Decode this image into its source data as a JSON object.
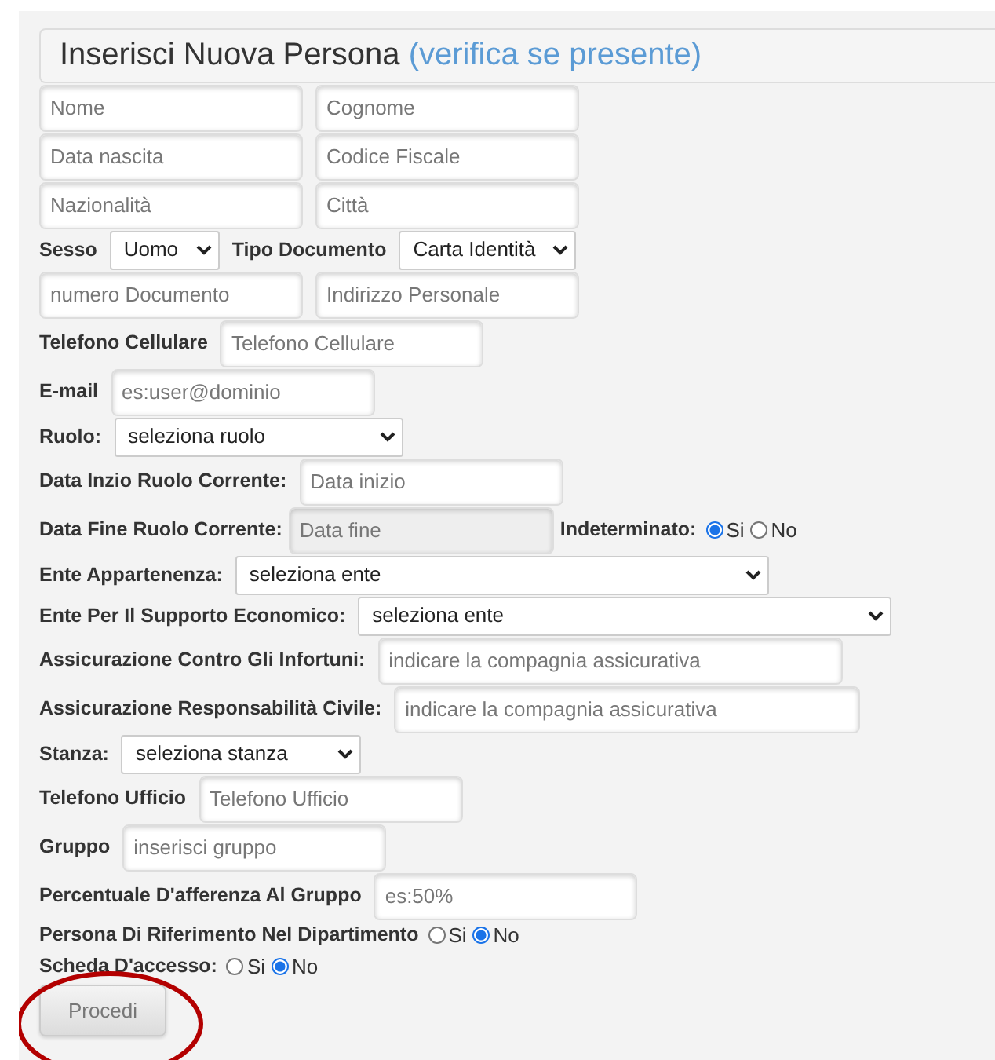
{
  "header": {
    "title": "Inserisci Nuova Persona",
    "link": "(verifica se presente)"
  },
  "rows": [
    {
      "items": [
        {
          "kind": "input",
          "placeholder": "Nome"
        },
        {
          "kind": "input",
          "placeholder": "Cognome"
        }
      ]
    },
    {
      "items": [
        {
          "kind": "input",
          "placeholder": "Data nascita"
        },
        {
          "kind": "input",
          "placeholder": "Codice Fiscale"
        }
      ]
    },
    {
      "items": [
        {
          "kind": "input",
          "placeholder": "Nazionalità"
        },
        {
          "kind": "input",
          "placeholder": "Città"
        }
      ]
    },
    {
      "items": [
        {
          "kind": "label",
          "text": "Sesso"
        },
        {
          "kind": "select",
          "value": "Uomo"
        },
        {
          "kind": "label",
          "text": "Tipo Documento"
        },
        {
          "kind": "select",
          "value": "Carta Identità"
        }
      ]
    },
    {
      "items": [
        {
          "kind": "input",
          "placeholder": "numero Documento"
        },
        {
          "kind": "input",
          "placeholder": "Indirizzo Personale"
        }
      ]
    },
    {
      "items": [
        {
          "kind": "label",
          "text": "Telefono Cellulare"
        },
        {
          "kind": "input",
          "placeholder": "Telefono Cellulare"
        }
      ]
    },
    {
      "items": [
        {
          "kind": "label",
          "text": "E-mail"
        },
        {
          "kind": "input",
          "placeholder": "es:user@dominio"
        }
      ]
    },
    {
      "items": [
        {
          "kind": "label",
          "text": "Ruolo:"
        },
        {
          "kind": "select",
          "value": "seleziona ruolo"
        }
      ]
    },
    {
      "items": [
        {
          "kind": "label",
          "text": "Data Inzio Ruolo Corrente:"
        },
        {
          "kind": "input",
          "placeholder": "Data inizio"
        }
      ]
    },
    {
      "items": [
        {
          "kind": "label",
          "text": "Data Fine Ruolo Corrente:"
        },
        {
          "kind": "input",
          "placeholder": "Data fine",
          "disabled": true
        },
        {
          "kind": "label",
          "text": "Indeterminato:"
        },
        {
          "kind": "radio",
          "options": [
            {
              "label": "Si",
              "selected": true
            },
            {
              "label": "No",
              "selected": false
            }
          ]
        }
      ]
    },
    {
      "items": [
        {
          "kind": "label",
          "text": "Ente Appartenenza:"
        },
        {
          "kind": "select",
          "value": "seleziona ente"
        }
      ]
    },
    {
      "items": [
        {
          "kind": "label",
          "text": "Ente Per Il Supporto Economico:"
        },
        {
          "kind": "select",
          "value": "seleziona ente"
        }
      ]
    },
    {
      "items": [
        {
          "kind": "label",
          "text": "Assicurazione Contro Gli Infortuni:"
        },
        {
          "kind": "input",
          "placeholder": "indicare la compagnia assicurativa"
        }
      ]
    },
    {
      "items": [
        {
          "kind": "label",
          "text": "Assicurazione Responsabilità Civile:"
        },
        {
          "kind": "input",
          "placeholder": "indicare la compagnia assicurativa"
        }
      ]
    },
    {
      "items": [
        {
          "kind": "label",
          "text": "Stanza:"
        },
        {
          "kind": "select",
          "value": "seleziona stanza"
        }
      ]
    },
    {
      "items": [
        {
          "kind": "label",
          "text": "Telefono Ufficio"
        },
        {
          "kind": "input",
          "placeholder": "Telefono Ufficio"
        }
      ]
    },
    {
      "items": [
        {
          "kind": "label",
          "text": "Gruppo"
        },
        {
          "kind": "input",
          "placeholder": "inserisci gruppo"
        }
      ]
    },
    {
      "items": [
        {
          "kind": "label",
          "text": "Percentuale D'afferenza Al Gruppo"
        },
        {
          "kind": "input",
          "placeholder": "es:50%"
        }
      ]
    },
    {
      "items": [
        {
          "kind": "label",
          "text": "Persona Di Riferimento Nel Dipartimento"
        },
        {
          "kind": "radio",
          "options": [
            {
              "label": "Si",
              "selected": false
            },
            {
              "label": "No",
              "selected": true
            }
          ]
        }
      ]
    },
    {
      "items": [
        {
          "kind": "label",
          "text": "Scheda D'accesso:"
        },
        {
          "kind": "radio",
          "options": [
            {
              "label": "Si",
              "selected": false
            },
            {
              "label": "No",
              "selected": true
            }
          ]
        }
      ]
    }
  ],
  "submit": {
    "label": "Procedi",
    "highlighted": true
  }
}
